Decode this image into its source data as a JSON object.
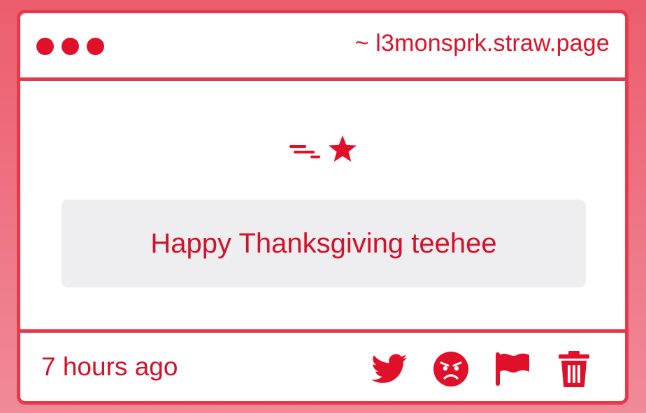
{
  "window": {
    "url": "~ l3monsprk.straw.page"
  },
  "post": {
    "message": "Happy Thanksgiving teehee",
    "timestamp": "7 hours ago"
  },
  "icons": {
    "header": "shooting-star-icon",
    "actions": [
      "twitter-icon",
      "angry-face-icon",
      "flag-icon",
      "trash-icon"
    ]
  },
  "colors": {
    "accent": "#e0102a",
    "border": "#e8384b",
    "message_bg": "#eeedef",
    "background": "#ec5d6d"
  }
}
